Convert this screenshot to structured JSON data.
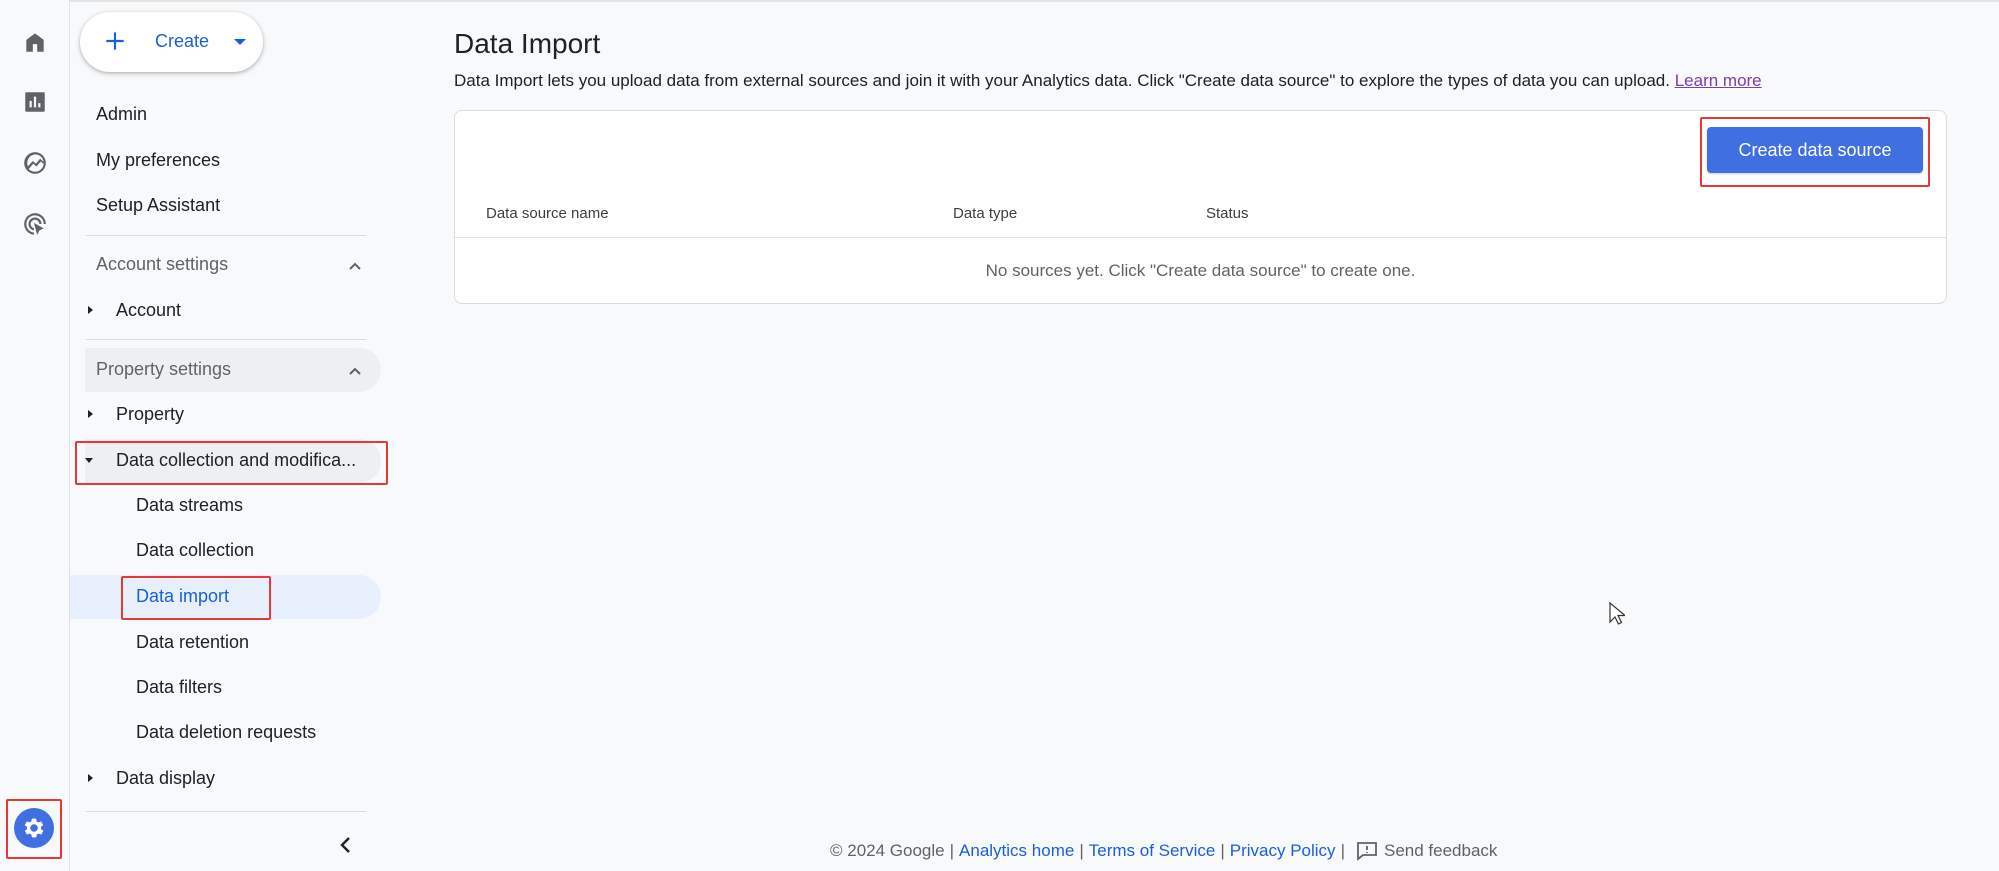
{
  "rail": {
    "icons": [
      "home-icon",
      "reports-icon",
      "explore-icon",
      "advertising-icon"
    ],
    "settings_icon": "gear-icon"
  },
  "nav": {
    "create_label": "Create",
    "top_items": [
      "Admin",
      "My preferences",
      "Setup Assistant"
    ],
    "account_settings": {
      "label": "Account settings",
      "items": [
        "Account"
      ]
    },
    "property_settings": {
      "label": "Property settings",
      "items": [
        "Property",
        "Data collection and modifica..."
      ],
      "data_collection_children": [
        "Data streams",
        "Data collection",
        "Data import",
        "Data retention",
        "Data filters",
        "Data deletion requests"
      ],
      "after_items": [
        "Data display"
      ]
    },
    "active_item": "Data import"
  },
  "main": {
    "title": "Data Import",
    "description": "Data Import lets you upload data from external sources and join it with your Analytics data. Click \"Create data source\" to explore the types of data you can upload.",
    "learn_more": "Learn more",
    "create_button": "Create data source",
    "columns": [
      "Data source name",
      "Data type",
      "Status"
    ],
    "empty_message": "No sources yet. Click \"Create data source\" to create one."
  },
  "footer": {
    "copyright": "© 2024 Google",
    "links": [
      "Analytics home",
      "Terms of Service",
      "Privacy Policy"
    ],
    "feedback": "Send feedback"
  },
  "colors": {
    "accent": "#3f6fe0",
    "link": "#1a5fd8",
    "highlight": "#e53935",
    "active_bg": "#e8f0fe"
  }
}
